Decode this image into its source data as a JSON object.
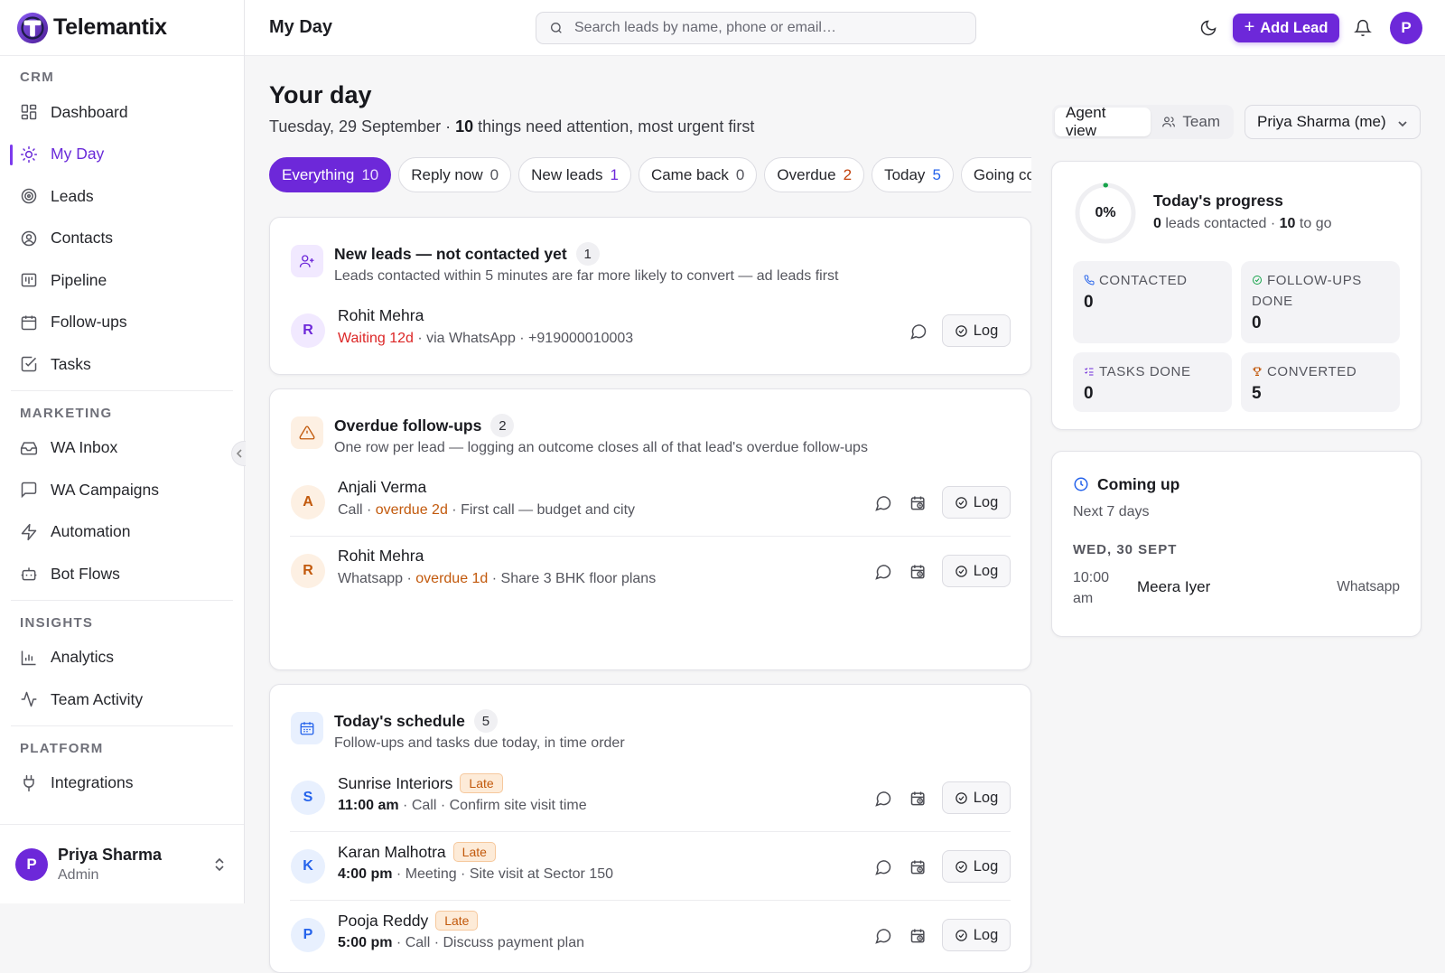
{
  "app": {
    "name": "Telemantix"
  },
  "sidebar": {
    "sections": [
      {
        "title": "CRM",
        "items": [
          {
            "label": "Dashboard",
            "icon": "dashboard-icon"
          },
          {
            "label": "My Day",
            "icon": "sun-icon",
            "active": true
          },
          {
            "label": "Leads",
            "icon": "target-icon"
          },
          {
            "label": "Contacts",
            "icon": "user-circle-icon"
          },
          {
            "label": "Pipeline",
            "icon": "kanban-icon"
          },
          {
            "label": "Follow-ups",
            "icon": "calendar-icon"
          },
          {
            "label": "Tasks",
            "icon": "checkbox-icon"
          }
        ]
      },
      {
        "title": "MARKETING",
        "items": [
          {
            "label": "WA Inbox",
            "icon": "inbox-icon"
          },
          {
            "label": "WA Campaigns",
            "icon": "message-square-icon"
          },
          {
            "label": "Automation",
            "icon": "zap-icon"
          },
          {
            "label": "Bot Flows",
            "icon": "bot-icon"
          }
        ]
      },
      {
        "title": "INSIGHTS",
        "items": [
          {
            "label": "Analytics",
            "icon": "bar-chart-icon"
          },
          {
            "label": "Team Activity",
            "icon": "activity-icon"
          }
        ]
      },
      {
        "title": "PLATFORM",
        "items": [
          {
            "label": "Integrations",
            "icon": "plug-icon"
          }
        ]
      }
    ],
    "user": {
      "initial": "P",
      "name": "Priya Sharma",
      "role": "Admin"
    }
  },
  "topbar": {
    "title": "My Day",
    "search_placeholder": "Search leads by name, phone or email…",
    "add_lead": "Add Lead",
    "avatar_initial": "P"
  },
  "main": {
    "heading": "Your day",
    "date": "Tuesday, 29 September",
    "attention_sep": " · ",
    "attention_count": "10",
    "attention_text": " things need attention, most urgent first",
    "filters": [
      {
        "label": "Everything",
        "count": "10",
        "color": "active"
      },
      {
        "label": "Reply now",
        "count": "0",
        "color": "gray"
      },
      {
        "label": "New leads",
        "count": "1",
        "color": "purple"
      },
      {
        "label": "Came back",
        "count": "0",
        "color": "gray"
      },
      {
        "label": "Overdue",
        "count": "2",
        "color": "orange"
      },
      {
        "label": "Today",
        "count": "5",
        "color": "blue"
      },
      {
        "label": "Going cold",
        "count": "",
        "color": "gray"
      }
    ],
    "new_leads": {
      "title": "New leads — not contacted yet",
      "count": "1",
      "subtitle": "Leads contacted within 5 minutes are far more likely to convert — ad leads first",
      "rows": [
        {
          "initial": "R",
          "name": "Rohit Mehra",
          "status": "Waiting 12d",
          "meta": " · via WhatsApp · +919000010003",
          "action": "Log"
        }
      ]
    },
    "overdue": {
      "title": "Overdue follow-ups",
      "count": "2",
      "subtitle": "One row per lead — logging an outcome closes all of that lead's overdue follow-ups",
      "rows": [
        {
          "initial": "A",
          "name": "Anjali Verma",
          "type": "Call",
          "overdue": "overdue 2d",
          "note": "First call — budget and city",
          "action": "Log"
        },
        {
          "initial": "R",
          "name": "Rohit Mehra",
          "type": "Whatsapp",
          "overdue": "overdue 1d",
          "note": "Share 3 BHK floor plans",
          "action": "Log"
        }
      ]
    },
    "schedule": {
      "title": "Today's schedule",
      "count": "5",
      "subtitle": "Follow-ups and tasks due today, in time order",
      "rows": [
        {
          "initial": "S",
          "name": "Sunrise Interiors",
          "badge": "Late",
          "time": "11:00 am",
          "detail": " · Call · Confirm site visit time",
          "action": "Log"
        },
        {
          "initial": "K",
          "name": "Karan Malhotra",
          "badge": "Late",
          "time": "4:00 pm",
          "detail": " · Meeting · Site visit at Sector 150",
          "action": "Log"
        },
        {
          "initial": "P",
          "name": "Pooja Reddy",
          "badge": "Late",
          "time": "5:00 pm",
          "detail": " · Call · Discuss payment plan",
          "action": "Log"
        }
      ]
    }
  },
  "right": {
    "view_toggle": {
      "agent": "Agent view",
      "team": "Team"
    },
    "agent_select": "Priya Sharma (me)",
    "progress": {
      "percent_label": "0%",
      "percent": 0,
      "title": "Today's progress",
      "contacted": "0",
      "contacted_text": " leads contacted · ",
      "to_go": "10",
      "to_go_text": " to go"
    },
    "stats": [
      {
        "label": "CONTACTED",
        "value": "0",
        "icon": "phone-icon",
        "color": "#2563eb"
      },
      {
        "label": "FOLLOW-UPS DONE",
        "value": "0",
        "icon": "check-circle-icon",
        "color": "#16a34a"
      },
      {
        "label": "TASKS DONE",
        "value": "0",
        "icon": "list-checks-icon",
        "color": "#6d28d9"
      },
      {
        "label": "CONVERTED",
        "value": "5",
        "icon": "trophy-icon",
        "color": "#c2590c"
      }
    ],
    "coming_up": {
      "title": "Coming up",
      "subtitle": "Next 7 days",
      "date_label": "WED, 30 SEPT",
      "items": [
        {
          "time": "10:00 am",
          "name": "Meera Iyer",
          "channel": "Whatsapp"
        }
      ]
    }
  },
  "colors": {
    "accent": "#6d28d9",
    "danger": "#dc2626",
    "warning": "#c2590c",
    "info": "#2563eb",
    "success": "#16a34a"
  }
}
